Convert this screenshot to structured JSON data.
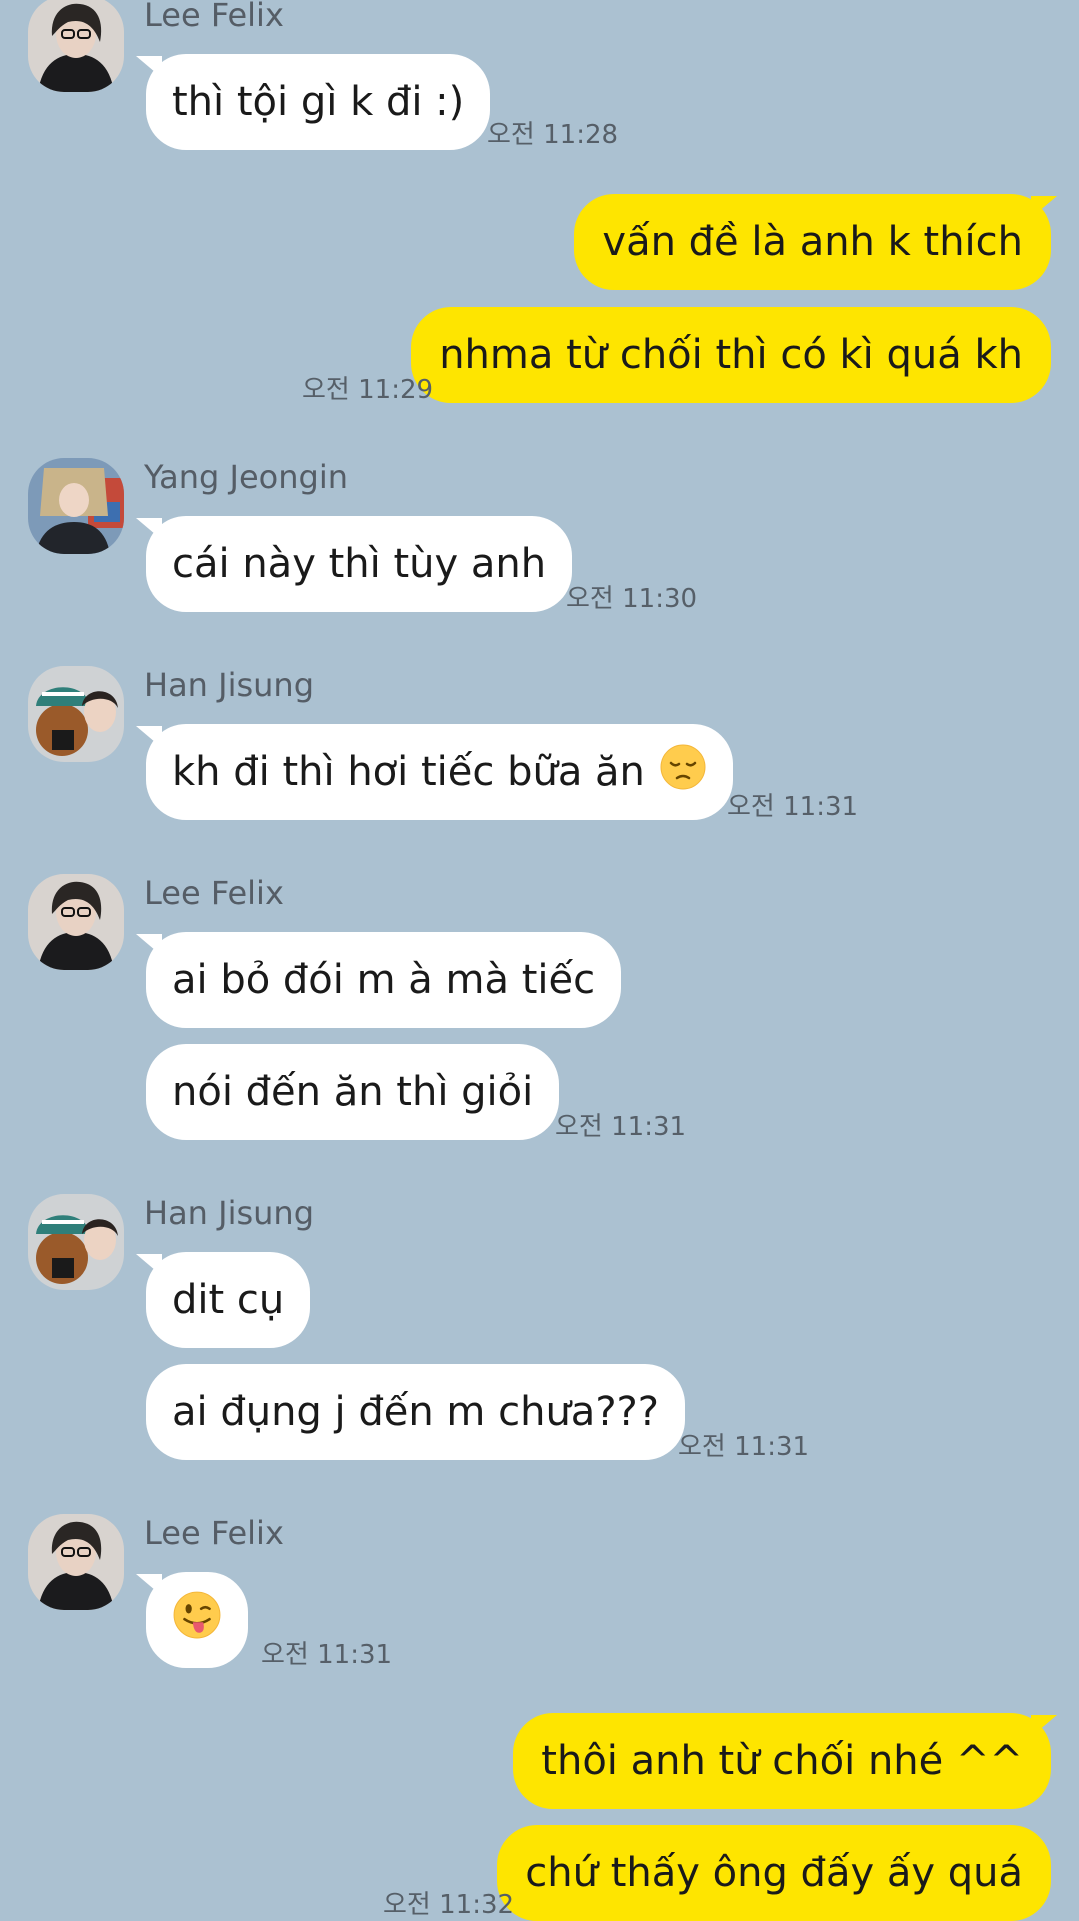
{
  "messages": {
    "m1": {
      "sender": "Lee Felix",
      "text": "thì tội gì k đi :)",
      "time": "오전 11:28"
    },
    "m2": {
      "text": "vấn đề là anh k thích"
    },
    "m3": {
      "text": "nhma từ chối thì có kì quá kh",
      "time": "오전 11:29"
    },
    "m4": {
      "sender": "Yang Jeongin",
      "text": "cái này thì tùy anh",
      "time": "오전 11:30"
    },
    "m5": {
      "sender": "Han Jisung",
      "text": "kh đi thì hơi tiếc bữa ăn",
      "emoji": "pensive-face-emoji",
      "time": "오전 11:31"
    },
    "m6": {
      "sender": "Lee Felix",
      "text": "ai bỏ đói m à mà tiếc"
    },
    "m7": {
      "text": "nói đến ăn thì giỏi",
      "time": "오전 11:31"
    },
    "m8": {
      "sender": "Han Jisung",
      "text": "dit cụ"
    },
    "m9": {
      "text": "ai đụng j đến m chưa???",
      "time": "오전 11:31"
    },
    "m10": {
      "sender": "Lee Felix",
      "emoji": "winking-face-with-tongue-emoji",
      "time": "오전 11:31"
    },
    "m11": {
      "text": "thôi anh từ chối nhé ^^"
    },
    "m12": {
      "text": "chứ thấy ông đấy ấy quá",
      "time": "오전 11:32"
    }
  },
  "colors": {
    "background": "#abc1d1",
    "incoming_bubble": "#ffffff",
    "outgoing_bubble": "#fee500"
  }
}
